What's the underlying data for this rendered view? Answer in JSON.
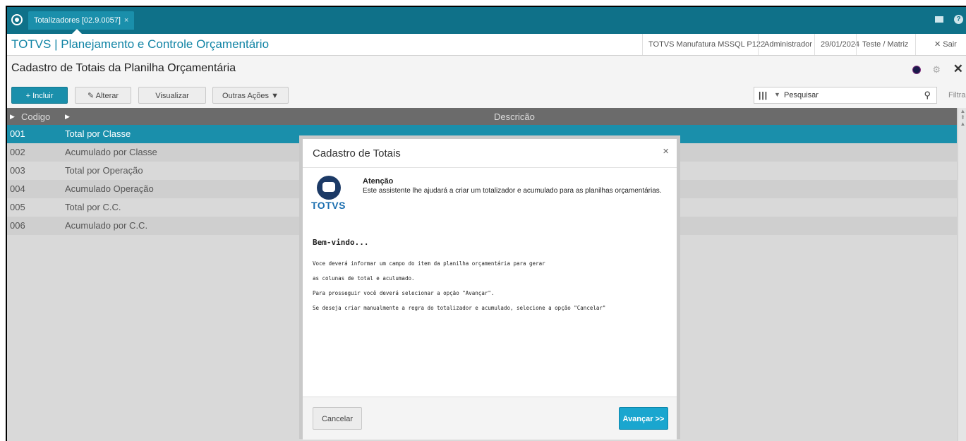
{
  "tabbar": {
    "tab_label": "Totalizadores [02.9.0057]",
    "tab_close": "×"
  },
  "appbar": {
    "title": "TOTVS | Planejamento e Controle Orçamentário",
    "environment": "TOTVS Manufatura MSSQL P122",
    "user": "Administrador",
    "date": "29/01/2024",
    "branch": "Teste / Matriz",
    "exit_label": "Sair"
  },
  "page": {
    "title": "Cadastro de Totais da Planilha Orçamentária"
  },
  "toolbar": {
    "incluir": "Incluir",
    "alterar": "Alterar",
    "visualizar": "Visualizar",
    "outras": "Outras Ações",
    "search_placeholder": "Pesquisar",
    "filtrar": "Filtrar"
  },
  "grid": {
    "columns": [
      "Codigo",
      "Descricão"
    ],
    "rows": [
      {
        "codigo": "001",
        "descricao": "Total por Classe"
      },
      {
        "codigo": "002",
        "descricao": "Acumulado por Classe"
      },
      {
        "codigo": "003",
        "descricao": "Total por Operação"
      },
      {
        "codigo": "004",
        "descricao": "Acumulado Operação"
      },
      {
        "codigo": "005",
        "descricao": "Total por C.C."
      },
      {
        "codigo": "006",
        "descricao": "Acumulado por C.C."
      }
    ],
    "selected_index": 0
  },
  "modal": {
    "title": "Cadastro de Totais",
    "logo_text": "TOTVS",
    "attention_title": "Atenção",
    "attention_text": "Este assistente lhe ajudará a criar um totalizador e acumulado para as planilhas orçamentárias.",
    "welcome": "Bem-vindo...",
    "lines": [
      "Voce deverá informar um campo do item da planilha orçamentária para gerar",
      "as colunas de total e aculumado.",
      "Para prosseguir você deverá selecionar a opção \"Avançar\".",
      "Se deseja criar manualmente a regra do totalizador e acumulado, selecione a opção \"Cancelar\""
    ],
    "cancel": "Cancelar",
    "next": "Avançar >>"
  },
  "colors": {
    "primary": "#1a8fab",
    "tabbar": "#0f7189",
    "title": "#1184a5"
  }
}
